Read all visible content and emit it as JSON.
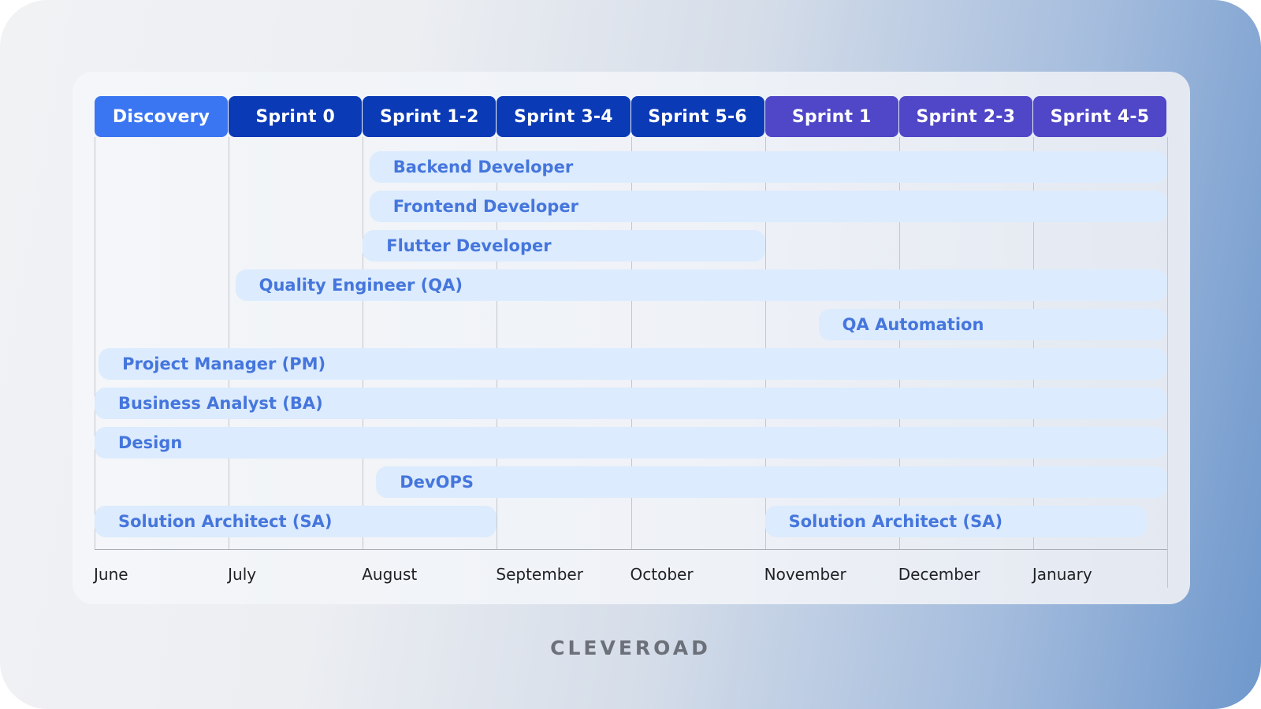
{
  "chart_data": {
    "type": "gantt",
    "title": "",
    "phases": [
      {
        "label": "Discovery",
        "color": "#3b76f2"
      },
      {
        "label": "Sprint 0",
        "color": "#0b3ab6"
      },
      {
        "label": "Sprint 1-2",
        "color": "#0b3ab6"
      },
      {
        "label": "Sprint 3-4",
        "color": "#0b3ab6"
      },
      {
        "label": "Sprint 5-6",
        "color": "#0b3ab6"
      },
      {
        "label": "Sprint 1",
        "color": "#4f46c8"
      },
      {
        "label": "Sprint 2-3",
        "color": "#4f46c8"
      },
      {
        "label": "Sprint 4-5",
        "color": "#4f46c8"
      }
    ],
    "months": [
      "June",
      "July",
      "August",
      "September",
      "October",
      "November",
      "December",
      "January"
    ],
    "x_range": [
      0,
      8
    ],
    "x_unit": "months from start of June",
    "tasks": [
      {
        "label": "Backend Developer",
        "start": 2.05,
        "end": 8.0
      },
      {
        "label": "Frontend Developer",
        "start": 2.05,
        "end": 8.0
      },
      {
        "label": "Flutter Developer",
        "start": 2.0,
        "end": 5.0
      },
      {
        "label": "Quality Engineer (QA)",
        "start": 1.05,
        "end": 8.0
      },
      {
        "label": "QA Automation",
        "start": 5.4,
        "end": 8.0
      },
      {
        "label": "Project Manager (PM)",
        "start": 0.03,
        "end": 8.0
      },
      {
        "label": "Business Analyst (BA)",
        "start": 0.0,
        "end": 8.0
      },
      {
        "label": "Design",
        "start": 0.0,
        "end": 8.0
      },
      {
        "label": "DevOPS",
        "start": 2.1,
        "end": 8.0
      },
      {
        "label": "Solution Architect (SA)",
        "start": 0.0,
        "end": 3.0
      },
      {
        "label": "Solution Architect (SA)",
        "start": 5.0,
        "end": 7.85
      }
    ],
    "grid": true
  },
  "brand": "CLEVEROAD"
}
